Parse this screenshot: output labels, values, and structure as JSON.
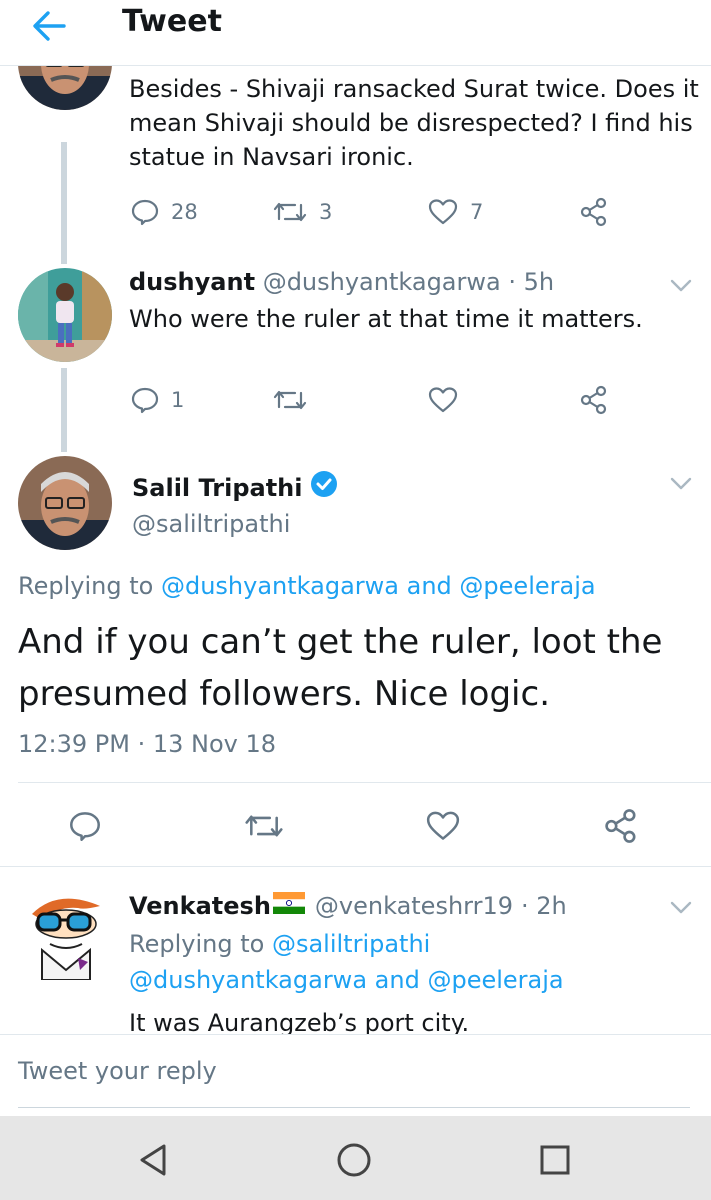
{
  "header": {
    "title": "Tweet"
  },
  "tweets": [
    {
      "text": "Besides - Shivaji ransacked Surat twice. Does it mean Shivaji should be disrespected? I find his statue in Navsari ironic.",
      "replies": "28",
      "retweets": "3",
      "likes": "7"
    },
    {
      "name": "dushyant",
      "handle": "@dushyantkagarwa",
      "time": "· 5h",
      "text": "Who were the ruler at that time it matters.",
      "replies": "1"
    }
  ],
  "main": {
    "name": "Salil Tripathi",
    "handle": "@saliltripathi",
    "replying_prefix": "Replying to",
    "mention1": "@dushyantkagarwa",
    "and": "and",
    "mention2": "@peeleraja",
    "text": "And if you can’t get the ruler, loot the presumed followers. Nice logic.",
    "timestamp": "12:39 PM · 13 Nov 18"
  },
  "reply": {
    "name": "Venkatesh",
    "handle": "@venkateshrr19",
    "time": "· 2h",
    "replying_prefix": "Replying to",
    "mention_a": "@saliltripathi",
    "mention_b": "@dushyantkagarwa",
    "and": "and",
    "mention_c": "@peeleraja",
    "text": "It was Aurangzeb’s port city."
  },
  "composer": {
    "placeholder": "Tweet your reply"
  },
  "colors": {
    "accent": "#1da1f2",
    "muted": "#657786",
    "verified": "#1da1f2"
  }
}
